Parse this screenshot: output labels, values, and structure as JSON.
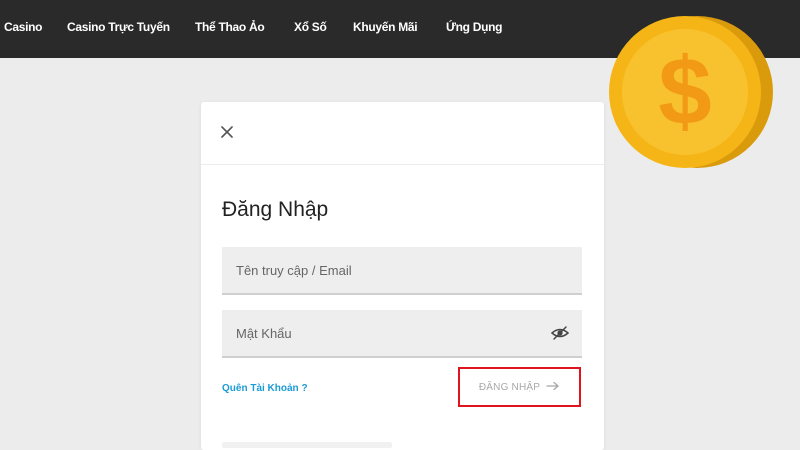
{
  "nav": {
    "items": [
      {
        "label": "Casino"
      },
      {
        "label": "Casino Trực Tuyến"
      },
      {
        "label": "Thể Thao Ảo"
      },
      {
        "label": "Xổ Số"
      },
      {
        "label": "Khuyến Mãi"
      },
      {
        "label": "Ứng Dụng"
      }
    ]
  },
  "login_modal": {
    "title": "Đăng Nhập",
    "username_placeholder": "Tên truy cập / Email",
    "password_placeholder": "Mật Khẩu",
    "forgot_label": "Quên Tài Khoản ?",
    "submit_label": "ĐĂNG NHẬP",
    "close_icon": "close-icon",
    "password_toggle_icon": "eye-icon"
  },
  "decoration": {
    "coin_symbol": "$",
    "coin_color": "#f5b517"
  },
  "colors": {
    "nav_background": "#2a2a2a",
    "page_background": "#ececec",
    "link": "#1a9ad6",
    "highlight": "#e0141e"
  }
}
